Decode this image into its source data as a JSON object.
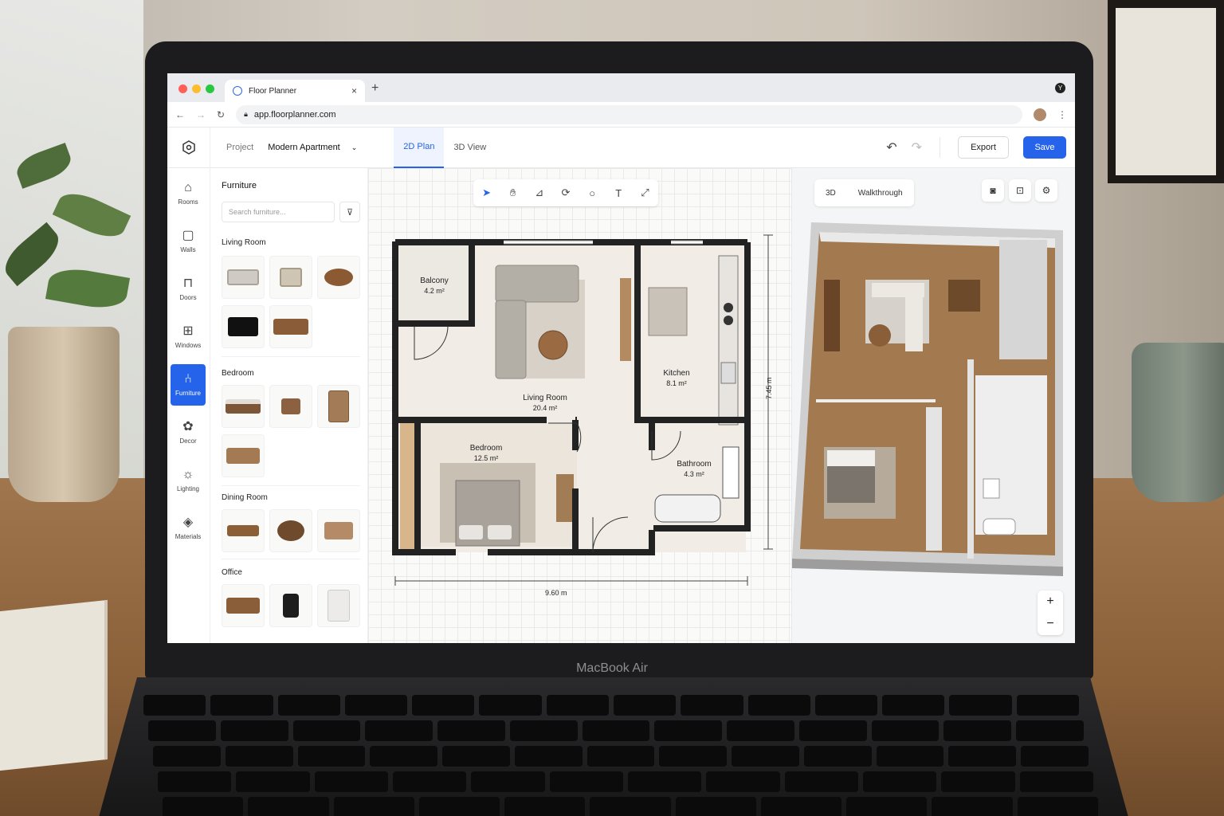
{
  "browser": {
    "tab_title": "Floor Planner",
    "tab_close": "×",
    "new_tab": "+",
    "url": "app.floorplanner.com",
    "profile_initial": "Y"
  },
  "header": {
    "project_label": "Project",
    "project_name": "Modern Apartment",
    "view_tabs": [
      "2D Plan",
      "3D View"
    ],
    "active_view": "2D Plan",
    "export_label": "Export",
    "save_label": "Save"
  },
  "rail": {
    "items": [
      "Rooms",
      "Walls",
      "Doors",
      "Windows",
      "Furniture",
      "Decor",
      "Lighting",
      "Materials"
    ],
    "active": "Furniture"
  },
  "panel": {
    "title": "Furniture",
    "search_placeholder": "Search furniture...",
    "categories": [
      "Living Room",
      "Bedroom",
      "Dining Room",
      "Office"
    ]
  },
  "plan": {
    "rooms": [
      {
        "name": "Balcony",
        "area": "4.2 m²"
      },
      {
        "name": "Living Room",
        "area": "20.4 m²"
      },
      {
        "name": "Kitchen",
        "area": "8.1 m²"
      },
      {
        "name": "Bedroom",
        "area": "12.5 m²"
      },
      {
        "name": "Bathroom",
        "area": "4.3 m²"
      }
    ],
    "width_label": "9.60 m",
    "height_label": "7.45 m"
  },
  "view3d": {
    "modes": [
      "3D",
      "Walkthrough"
    ],
    "zoom_in": "+",
    "zoom_out": "−"
  },
  "device": {
    "label": "MacBook Air"
  },
  "colors": {
    "accent": "#2563eb",
    "wall": "#222222",
    "floor_wood": "#a3794f"
  }
}
